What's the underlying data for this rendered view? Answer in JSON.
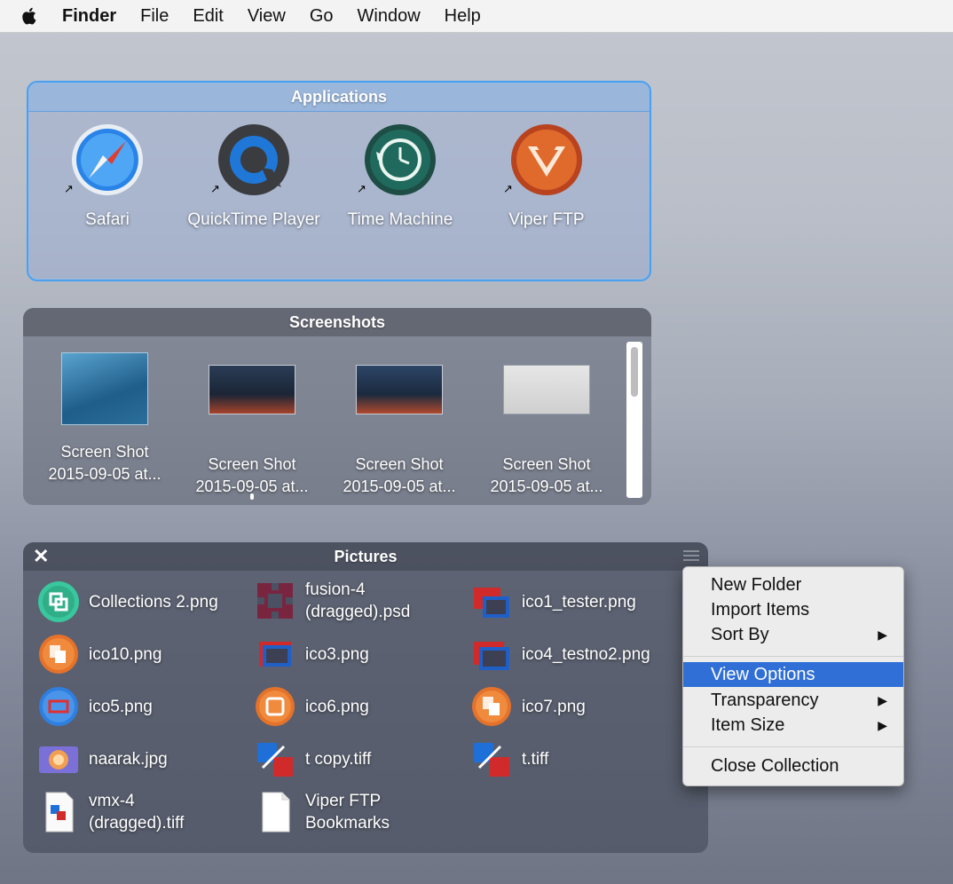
{
  "menubar": {
    "items": [
      "Finder",
      "File",
      "Edit",
      "View",
      "Go",
      "Window",
      "Help"
    ]
  },
  "applications": {
    "title": "Applications",
    "apps": [
      {
        "label": "Safari",
        "icon": "safari-icon"
      },
      {
        "label": "QuickTime Player",
        "icon": "quicktime-icon"
      },
      {
        "label": "Time Machine",
        "icon": "time-machine-icon"
      },
      {
        "label": "Viper FTP",
        "icon": "viper-ftp-icon"
      }
    ]
  },
  "screenshots": {
    "title": "Screenshots",
    "items": [
      {
        "line1": "Screen Shot",
        "line2": "2015-09-05 at..."
      },
      {
        "line1": "Screen Shot",
        "line2": "2015-09-05 at..."
      },
      {
        "line1": "Screen Shot",
        "line2": "2015-09-05 at..."
      },
      {
        "line1": "Screen Shot",
        "line2": "2015-09-05 at..."
      }
    ]
  },
  "pictures": {
    "title": "Pictures",
    "close_glyph": "✕",
    "items": [
      {
        "line1": "Collections 2.png",
        "line2": ""
      },
      {
        "line1": "fusion-4",
        "line2": "(dragged).psd"
      },
      {
        "line1": "ico1_tester.png",
        "line2": ""
      },
      {
        "line1": "ico10.png",
        "line2": ""
      },
      {
        "line1": "ico3.png",
        "line2": ""
      },
      {
        "line1": "ico4_testno2.png",
        "line2": ""
      },
      {
        "line1": "ico5.png",
        "line2": ""
      },
      {
        "line1": "ico6.png",
        "line2": ""
      },
      {
        "line1": "ico7.png",
        "line2": ""
      },
      {
        "line1": "naarak.jpg",
        "line2": ""
      },
      {
        "line1": "t copy.tiff",
        "line2": ""
      },
      {
        "line1": "t.tiff",
        "line2": ""
      },
      {
        "line1": "vmx-4",
        "line2": "(dragged).tiff"
      },
      {
        "line1": "Viper FTP",
        "line2": "Bookmarks"
      }
    ]
  },
  "context_menu": {
    "items": [
      {
        "label": "New Folder",
        "submenu": false
      },
      {
        "label": "Import Items",
        "submenu": false
      },
      {
        "label": "Sort By",
        "submenu": true
      },
      {
        "label": "View Options",
        "submenu": false,
        "highlighted": true
      },
      {
        "label": "Transparency",
        "submenu": true
      },
      {
        "label": "Item Size",
        "submenu": true
      },
      {
        "label": "Close Collection",
        "submenu": false
      }
    ],
    "arrow_glyph": "▶",
    "highlight_color": "#2f6fd6"
  }
}
